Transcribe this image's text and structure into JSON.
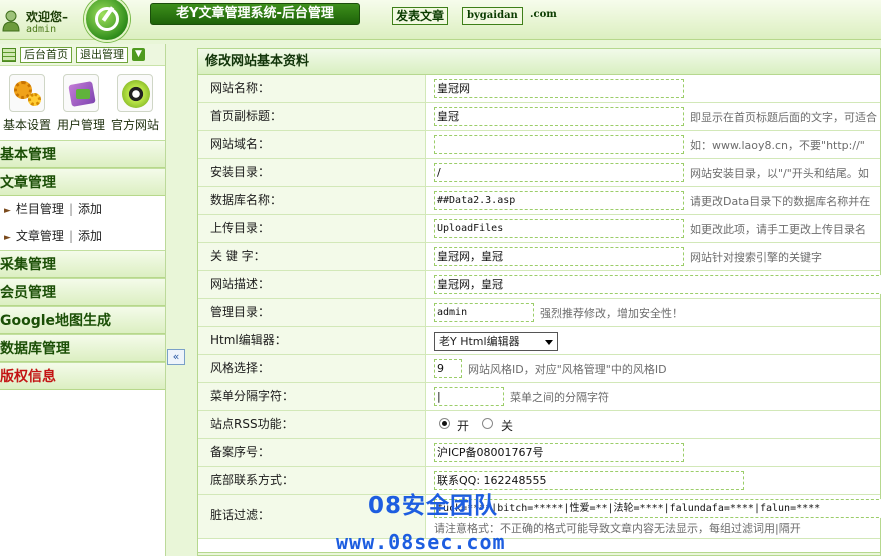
{
  "header": {
    "welcome": "欢迎您–",
    "username": "admin",
    "system_title": "老Y文章管理系统-后台管理",
    "post_article": "发表文章",
    "site_link": "bygaidan",
    "site_domain": ".com"
  },
  "sidebar": {
    "home_button": "后台首页",
    "logout_button": "退出管理",
    "quick_links": [
      {
        "label": "基本设置",
        "icon": "gears-icon"
      },
      {
        "label": "用户管理",
        "icon": "users-icon"
      },
      {
        "label": "官方网站",
        "icon": "radiation-icon"
      }
    ],
    "menu": {
      "basic": "基本管理",
      "article": "文章管理",
      "column_manage": "栏目管理",
      "column_add": "添加",
      "article_manage": "文章管理",
      "article_add": "添加",
      "collect": "采集管理",
      "member": "会员管理",
      "google_map": "Google地图生成",
      "database": "数据库管理",
      "copyright": "版权信息"
    },
    "collapse_glyph": "«"
  },
  "panel": {
    "title": "修改网站基本资料",
    "fields": {
      "site_name": {
        "label": "网站名称：",
        "value": "皇冠网"
      },
      "subtitle": {
        "label": "首页副标题：",
        "value": "皇冠",
        "hint": "即显示在首页标题后面的文字，可适合"
      },
      "domain": {
        "label": "网站域名：",
        "value": "",
        "hint": "如：www.laoy8.cn，不要\"http://\""
      },
      "install_dir": {
        "label": "安装目录：",
        "value": "/",
        "hint": "网站安装目录，以\"/\"开头和结尾。如"
      },
      "db_name": {
        "label": "数据库名称：",
        "value": "##Data2.3.asp",
        "hint": "请更改Data目录下的数据库名称并在"
      },
      "upload_dir": {
        "label": "上传目录：",
        "value": "UploadFiles",
        "hint": "如更改此项，请手工更改上传目录名"
      },
      "keywords": {
        "label": "关 键 字：",
        "value": "皇冠网，皇冠",
        "hint": "网站针对搜索引擎的关键字"
      },
      "description": {
        "label": "网站描述：",
        "value": "皇冠网，皇冠"
      },
      "admin_dir": {
        "label": "管理目录：",
        "value": "admin",
        "hint": "强烈推荐修改，增加安全性！"
      },
      "editor": {
        "label": "Html编辑器：",
        "value": "老Y Html编辑器"
      },
      "style": {
        "label": "风格选择：",
        "value": "9",
        "hint": "网站风格ID，对应\"风格管理\"中的风格ID"
      },
      "menu_sep": {
        "label": "菜单分隔字符：",
        "value": "|",
        "hint": "菜单之间的分隔字符"
      },
      "rss": {
        "label": "站点RSS功能：",
        "on": "开",
        "off": "关"
      },
      "icp": {
        "label": "备案序号：",
        "value": "沪ICP备08001767号"
      },
      "contact": {
        "label": "底部联系方式：",
        "value": "联系QQ: 162248555"
      },
      "filter": {
        "label": "脏话过滤：",
        "value": "fuck=****|bitch=*****|性爱=**|法轮=****|falundafa=****|falun=****",
        "hint": "请注意格式：不正确的格式可能导致文章内容无法显示，每组过滤词用|隔开"
      }
    }
  },
  "watermark": {
    "line1": "08安全团队",
    "line2": "www.08sec.com"
  }
}
